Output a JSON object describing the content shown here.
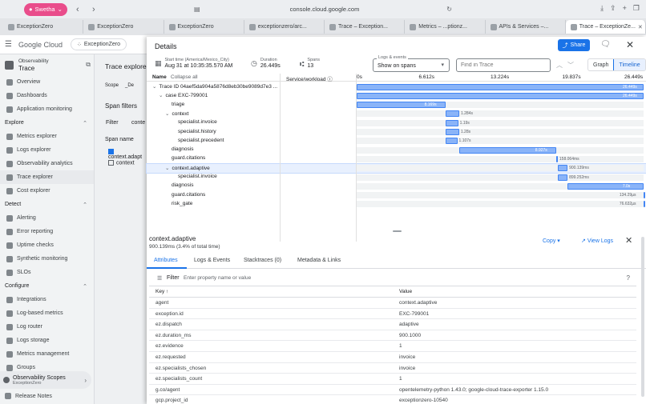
{
  "browser": {
    "profile_name": "Swetha",
    "url": "console.cloud.google.com",
    "tabs": [
      {
        "label": "ExceptionZero",
        "active": false
      },
      {
        "label": "ExceptionZero",
        "active": false
      },
      {
        "label": "ExceptionZero",
        "active": false
      },
      {
        "label": "exceptionzero/arc...",
        "active": false
      },
      {
        "label": "Trace – Exception...",
        "active": false
      },
      {
        "label": "Metrics – ...ptionz...",
        "active": false
      },
      {
        "label": "APIs & Services –...",
        "active": false
      },
      {
        "label": "Trace – ExceptionZe...",
        "active": true
      }
    ]
  },
  "header": {
    "logo": "Google Cloud",
    "project": "ExceptionZero"
  },
  "sidebar": {
    "product_line": "Observability",
    "product_name": "Trace",
    "items_top": [
      "Overview",
      "Dashboards",
      "Application monitoring"
    ],
    "section_explore": "Explore",
    "items_explore": [
      "Metrics explorer",
      "Logs explorer",
      "Observability analytics",
      "Trace explorer",
      "Cost explorer"
    ],
    "section_detect": "Detect",
    "items_detect": [
      "Alerting",
      "Error reporting",
      "Uptime checks",
      "Synthetic monitoring",
      "SLOs"
    ],
    "section_configure": "Configure",
    "items_configure": [
      "Integrations",
      "Log-based metrics",
      "Log router",
      "Logs storage",
      "Metrics management",
      "Groups"
    ],
    "scopes_title": "Observability Scopes",
    "scopes_sub": "ExceptionZero",
    "release_notes": "Release Notes"
  },
  "bg": {
    "title": "Trace explore",
    "scope_label": "Scope",
    "scope_value": "_De",
    "span_filters": "Span filters",
    "filter": "Filter",
    "filter_val": "conte",
    "span_name": "Span name",
    "opt1": "context.adapt",
    "opt2": "context"
  },
  "details": {
    "title": "Details",
    "share": "Share",
    "start_label": "Start time (America/Mexico_City)",
    "start_value": "Aug 31 at 10:35:35.570 AM",
    "duration_label": "Duration",
    "duration_value": "26.449s",
    "spans_label": "Spans",
    "spans_value": "13",
    "logs_label": "Logs & events",
    "logs_value": "Show on spans",
    "find_placeholder": "Find in Trace",
    "view_graph": "Graph",
    "view_timeline": "Timeline"
  },
  "tree": {
    "col_name": "Name",
    "col_collapse": "Collapse all",
    "col_service": "Service/workload",
    "ticks": [
      "0s",
      "6.612s",
      "13.224s",
      "19.837s",
      "26.449s"
    ],
    "total": 26.449,
    "rows": [
      {
        "name": "Trace ID 04aef5da904a5876d8eb30be9089d7e3 ...",
        "indent": 0,
        "toggle": "v",
        "start": 0,
        "dur": 26.449,
        "label": "26.449s"
      },
      {
        "name": "case EXC-799001",
        "indent": 1,
        "toggle": "v",
        "start": 0,
        "dur": 26.449,
        "label": "26.449s"
      },
      {
        "name": "triage",
        "indent": 2,
        "toggle": "",
        "start": 0,
        "dur": 8.169,
        "label": "8.169s"
      },
      {
        "name": "context",
        "indent": 2,
        "toggle": "v",
        "start": 8.169,
        "dur": 1.284,
        "label": "1.284s"
      },
      {
        "name": "specialist.invoice",
        "indent": 3,
        "toggle": "",
        "start": 8.169,
        "dur": 1.19,
        "label": "1.19s"
      },
      {
        "name": "specialist.history",
        "indent": 3,
        "toggle": "",
        "start": 8.169,
        "dur": 1.28,
        "label": "1.28s"
      },
      {
        "name": "specialist.precedent",
        "indent": 3,
        "toggle": "",
        "start": 8.169,
        "dur": 1.107,
        "label": "1.107s"
      },
      {
        "name": "diagnosis",
        "indent": 2,
        "toggle": "",
        "start": 9.453,
        "dur": 8.927,
        "label": "8.927s"
      },
      {
        "name": "guard.citations",
        "indent": 2,
        "toggle": "",
        "start": 18.38,
        "dur": 0.158,
        "label": "158.064ms"
      },
      {
        "name": "context.adaptive",
        "indent": 2,
        "toggle": "v",
        "start": 18.538,
        "dur": 0.9,
        "label": "900.139ms",
        "selected": true
      },
      {
        "name": "specialist.invoice",
        "indent": 3,
        "toggle": "",
        "start": 18.538,
        "dur": 0.899,
        "label": "899.252ms"
      },
      {
        "name": "diagnosis",
        "indent": 2,
        "toggle": "",
        "start": 19.438,
        "dur": 7.0,
        "label": "7.0s"
      },
      {
        "name": "guard.citations",
        "indent": 2,
        "toggle": "",
        "start": 26.438,
        "dur": 0.0001,
        "label": "134.29µs"
      },
      {
        "name": "risk_gate",
        "indent": 2,
        "toggle": "",
        "start": 26.44,
        "dur": 0.0001,
        "label": "76.632µs"
      }
    ]
  },
  "span": {
    "name": "context.adaptive",
    "subtitle": "900.139ms (3.4% of total time)",
    "copy": "Copy",
    "view_logs": "View Logs",
    "tabs": [
      "Attributes",
      "Logs & Events",
      "Stacktraces (0)",
      "Metadata & Links"
    ],
    "filter_label": "Filter",
    "filter_placeholder": "Enter property name or value",
    "key_header": "Key",
    "value_header": "Value",
    "attributes": [
      {
        "k": "agent",
        "v": "context.adaptive"
      },
      {
        "k": "exception.id",
        "v": "EXC-799001"
      },
      {
        "k": "ez.dispatch",
        "v": "adaptive"
      },
      {
        "k": "ez.duration_ms",
        "v": "900.1000"
      },
      {
        "k": "ez.evidence",
        "v": "1"
      },
      {
        "k": "ez.requested",
        "v": "invoice"
      },
      {
        "k": "ez.specialists_chosen",
        "v": "invoice"
      },
      {
        "k": "ez.specialists_count",
        "v": "1"
      },
      {
        "k": "g.co/agent",
        "v": "opentelemetry-python 1.43.0; google-cloud-trace-exporter 1.15.0"
      },
      {
        "k": "gcp.project_id",
        "v": "exceptionzero-10540"
      }
    ]
  }
}
